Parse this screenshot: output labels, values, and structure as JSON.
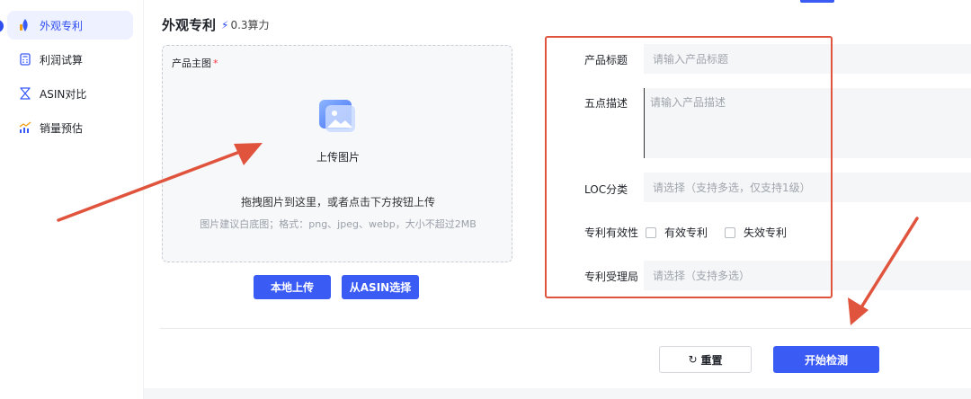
{
  "sidebar": {
    "items": [
      {
        "label": "外观专利",
        "icon": "design-patent-icon",
        "active": true
      },
      {
        "label": "利润试算",
        "icon": "calculator-icon",
        "active": false
      },
      {
        "label": "ASIN对比",
        "icon": "compare-icon",
        "active": false
      },
      {
        "label": "销量预估",
        "icon": "sales-chart-icon",
        "active": false
      }
    ]
  },
  "header": {
    "title": "外观专利",
    "credit": "0.3算力"
  },
  "upload": {
    "label": "产品主图",
    "required_mark": "*",
    "upload_text": "上传图片",
    "drag_text": "拖拽图片到这里，或者点击下方按钮上传",
    "hint_text": "图片建议白底图；格式：png、jpeg、webp，大小不超过2MB",
    "local_button": "本地上传",
    "asin_button": "从ASIN选择"
  },
  "form": {
    "title_label": "产品标题",
    "title_placeholder": "请输入产品标题",
    "desc_label": "五点描述",
    "desc_placeholder": "请输入产品描述",
    "loc_label": "LOC分类",
    "loc_placeholder": "请选择（支持多选，仅支持1级）",
    "validity_label": "专利有效性",
    "valid_option": "有效专利",
    "invalid_option": "失效专利",
    "office_label": "专利受理局",
    "office_placeholder": "请选择（支持多选）"
  },
  "actions": {
    "reset": "重置",
    "start": "开始检测"
  },
  "colors": {
    "primary": "#3b5bf5",
    "annotation": "#e0533c"
  }
}
